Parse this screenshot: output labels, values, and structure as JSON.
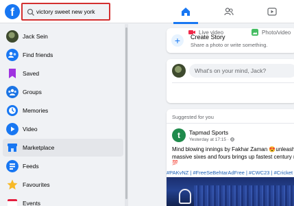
{
  "search": {
    "value": "victory sweet new york"
  },
  "brand": {
    "logo_letter": "f",
    "accent": "#1877f2",
    "highlight_border": "#d32f2f"
  },
  "nav_tabs": [
    {
      "icon": "home-icon",
      "active": true
    },
    {
      "icon": "friends-icon",
      "active": false
    },
    {
      "icon": "watch-icon",
      "active": false
    }
  ],
  "sidebar": {
    "items": [
      {
        "label": "Jack Sein",
        "icon": "user-avatar"
      },
      {
        "label": "Find friends",
        "icon": "find-friends-icon"
      },
      {
        "label": "Saved",
        "icon": "saved-icon"
      },
      {
        "label": "Groups",
        "icon": "groups-icon"
      },
      {
        "label": "Memories",
        "icon": "memories-icon"
      },
      {
        "label": "Video",
        "icon": "video-icon"
      },
      {
        "label": "Marketplace",
        "icon": "marketplace-icon"
      },
      {
        "label": "Feeds",
        "icon": "feeds-icon"
      },
      {
        "label": "Favourites",
        "icon": "favourites-icon"
      },
      {
        "label": "Events",
        "icon": "events-icon"
      }
    ]
  },
  "story": {
    "title": "Create Story",
    "subtitle": "Share a photo or write something."
  },
  "composer": {
    "placeholder": "What's on your mind, Jack?",
    "live_label": "Live video",
    "photo_label": "Photo/video"
  },
  "post": {
    "suggested": "Suggested for you",
    "page_name": "Tapmad Sports",
    "time": "Yesterday at 17:15 · ",
    "text_line1": "Mind blowing innings by Fakhar Zaman 😍unleashe",
    "text_line2": "massive sixes and fours brings up fastest century m",
    "text_line3": "💯",
    "hashtags": "#PAKvNZ | #FreeSeBehtarAdFree | #CWC23 | #Cricket"
  }
}
